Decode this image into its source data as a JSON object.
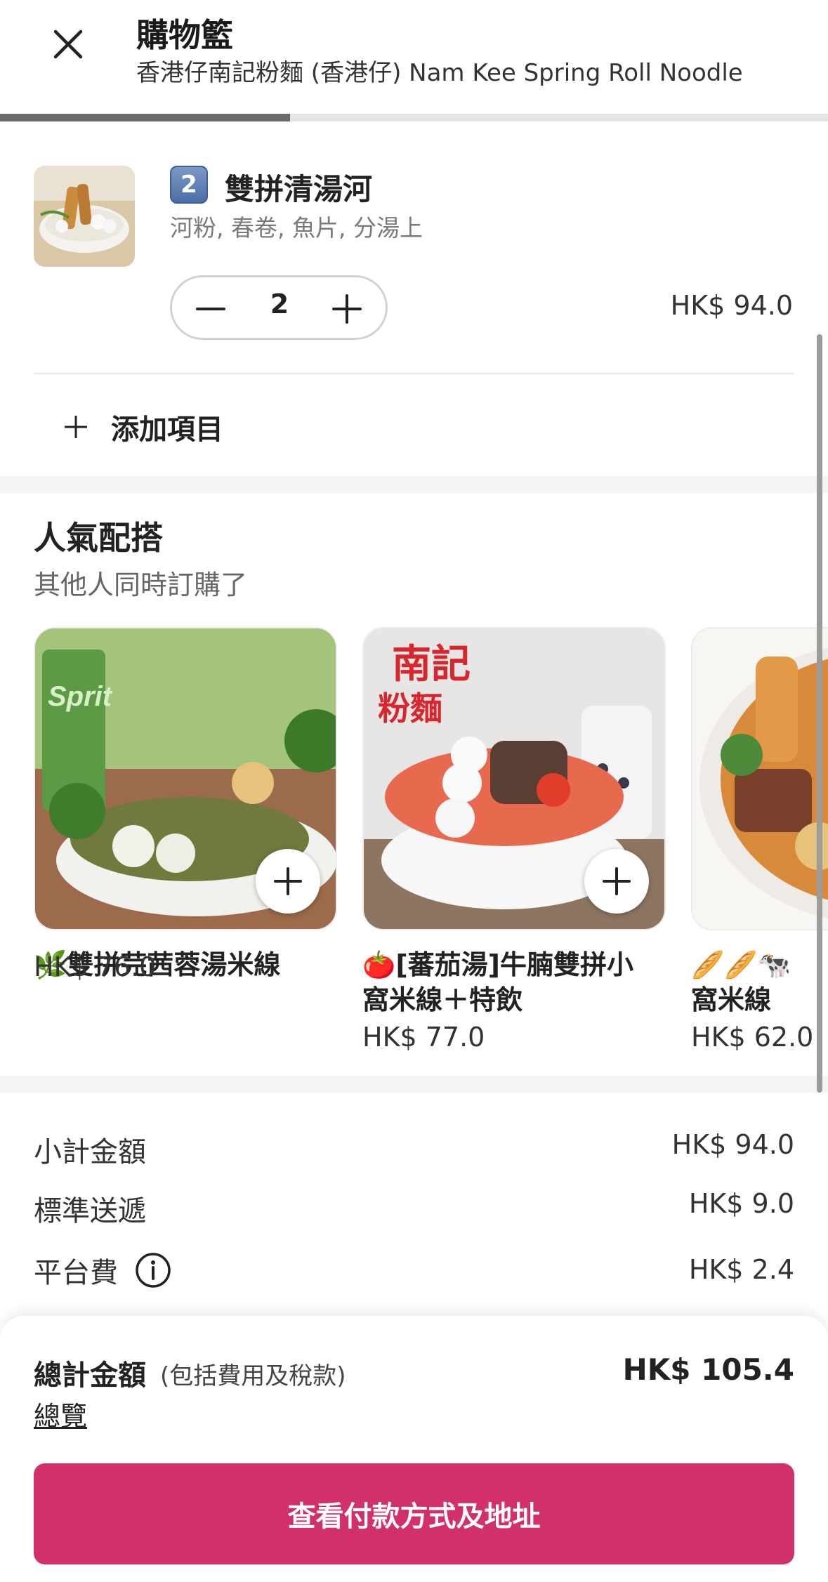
{
  "header": {
    "title": "購物籃",
    "subtitle": "香港仔南記粉麵 (香港仔) Nam Kee Spring Roll Noodle"
  },
  "progress": {
    "fraction": 0.35
  },
  "cart": {
    "item": {
      "badge": "2",
      "name": "雙拼清湯河",
      "description": "河粉, 春卷, 魚片, 分湯上",
      "quantity": "2",
      "price": "HK$ 94.0"
    },
    "add_item_label": "添加項目"
  },
  "recommendations": {
    "title": "人氣配搭",
    "subtitle": "其他人同時訂購了",
    "items": [
      {
        "name_line1": "🌿雙拼芫茜蓉湯米線",
        "name_line2": "",
        "price": "HK$ 76.0"
      },
      {
        "name_line1": "🍅[蕃茄湯]牛腩雙拼小",
        "name_line2": "窩米線＋特飲",
        "price": "HK$ 77.0"
      },
      {
        "name_line1": "🥖🥖🐄",
        "name_line2": "窩米線",
        "price": "HK$ 62.0"
      }
    ]
  },
  "fees": {
    "subtotal_label": "小計金額",
    "subtotal_value": "HK$ 94.0",
    "delivery_label": "標準送遞",
    "delivery_value": "HK$ 9.0",
    "platform_label": "平台費",
    "platform_value": "HK$ 2.4"
  },
  "summary": {
    "total_label": "總計金額",
    "total_note": "(包括費用及稅款)",
    "total_value": "HK$ 105.4",
    "overview_link": "總覽",
    "checkout_button": "查看付款方式及地址"
  },
  "colors": {
    "accent": "#d2306b",
    "progress_fill": "#6a6a6a",
    "progress_track": "#e4e4e4"
  }
}
